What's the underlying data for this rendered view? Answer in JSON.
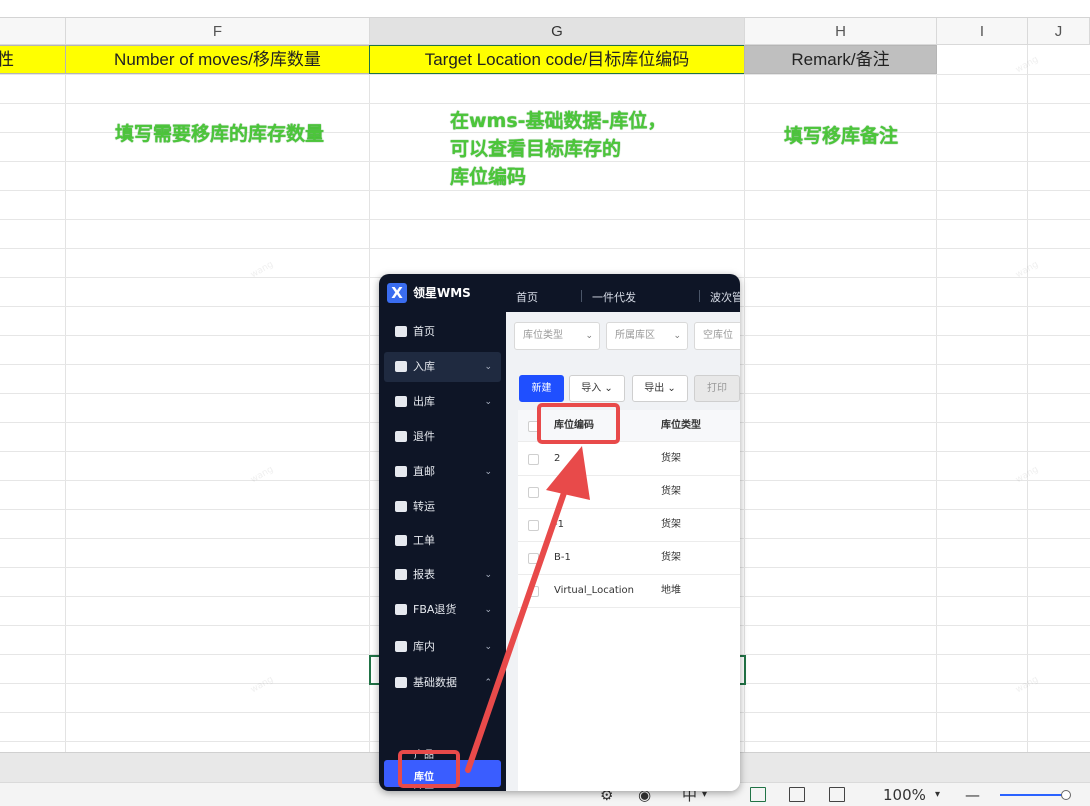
{
  "sheet": {
    "columns": [
      "F",
      "G",
      "H",
      "I",
      "J"
    ],
    "header_row": {
      "e_partial": "性",
      "f": "Number of moves/移库数量",
      "g": "Target Location code/目标库位编码",
      "h": "Remark/备注"
    },
    "notes": {
      "f": "填写需要移库的库存数量",
      "g_lines": [
        "在wms-基础数据-库位，",
        "可以查看目标库存的",
        "库位编码"
      ],
      "h": "填写移库备注"
    }
  },
  "wms": {
    "brand": "领星WMS",
    "logo_glyph": "X",
    "top_nav": [
      "首页",
      "一件代发",
      "波次管"
    ],
    "menu": [
      {
        "label": "首页",
        "icon": "home-icon",
        "chevron": false
      },
      {
        "label": "入库",
        "icon": "inbound-icon",
        "chevron": true
      },
      {
        "label": "出库",
        "icon": "outbound-icon",
        "chevron": true
      },
      {
        "label": "退件",
        "icon": "return-icon",
        "chevron": false
      },
      {
        "label": "直邮",
        "icon": "direct-mail-icon",
        "chevron": true
      },
      {
        "label": "转运",
        "icon": "transfer-icon",
        "chevron": false
      },
      {
        "label": "工单",
        "icon": "work-order-icon",
        "chevron": false
      },
      {
        "label": "报表",
        "icon": "report-icon",
        "chevron": true
      },
      {
        "label": "FBA退货",
        "icon": "fba-return-icon",
        "chevron": true
      },
      {
        "label": "库内",
        "icon": "in-warehouse-icon",
        "chevron": true
      },
      {
        "label": "基础数据",
        "icon": "base-data-icon",
        "chevron": true
      }
    ],
    "submenu": [
      "产品",
      "库区",
      "库位"
    ],
    "filters": [
      "库位类型",
      "所属库区",
      "空库位"
    ],
    "buttons": {
      "new": "新建",
      "import": "导入",
      "export": "导出",
      "print": "打印"
    },
    "table": {
      "headers": [
        "库位编码",
        "库位类型"
      ],
      "rows": [
        [
          "2",
          "货架"
        ],
        [
          "",
          "货架"
        ],
        [
          "-1",
          "货架"
        ],
        [
          "B-1",
          "货架"
        ],
        [
          "Virtual_Location",
          "地堆"
        ]
      ]
    }
  },
  "status_bar": {
    "input_mode": "中",
    "zoom": "100%"
  },
  "colors": {
    "yellow_header": "#ffff00",
    "gray_header": "#bfbfbf",
    "note_green": "#4cc63a",
    "wms_dark": "#0e1526",
    "wms_primary": "#1f4fff",
    "highlight_red": "#e84a4a"
  }
}
